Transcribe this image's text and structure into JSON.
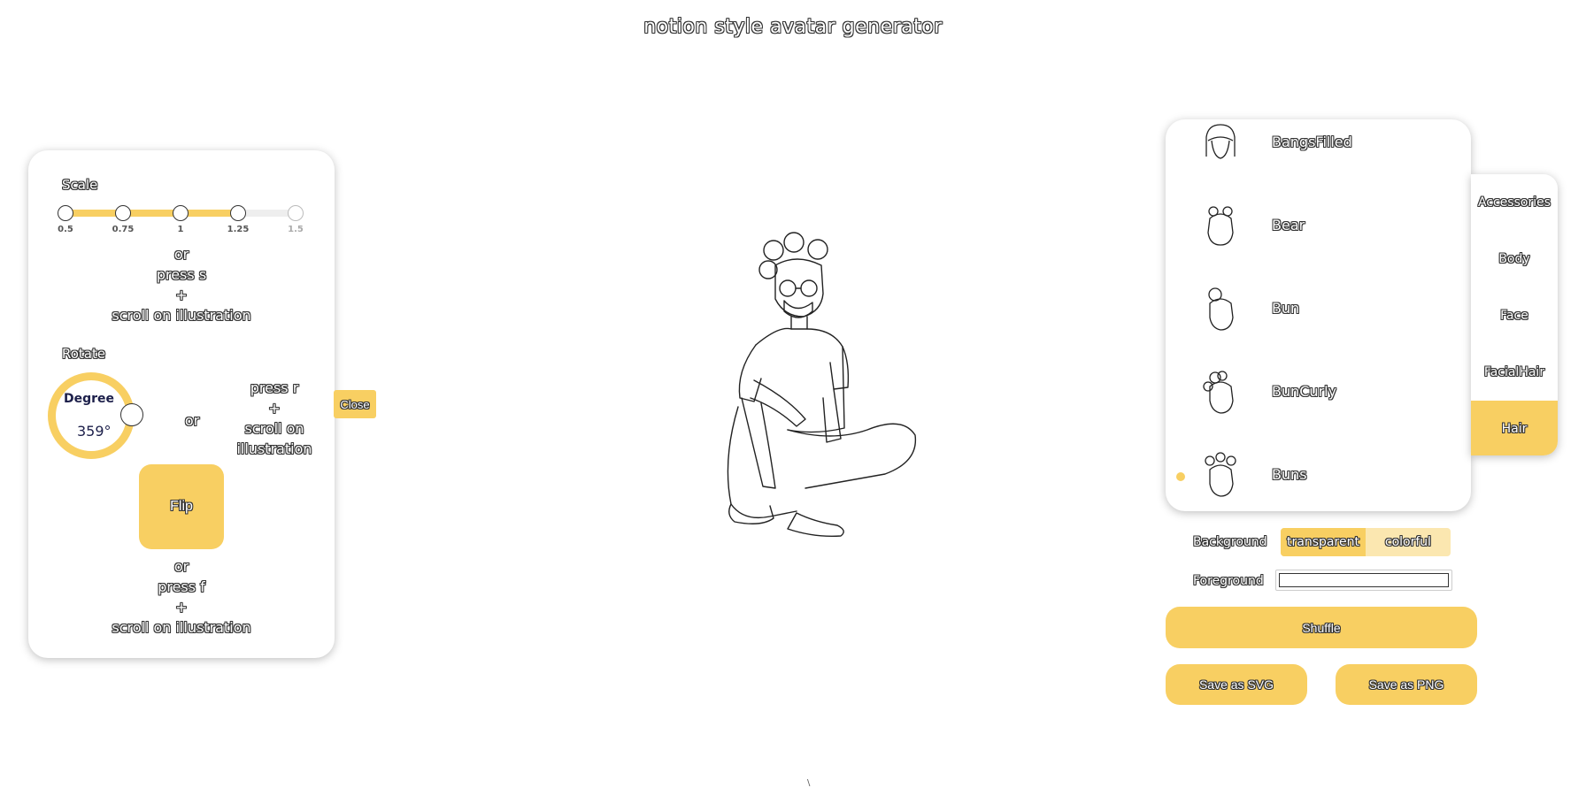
{
  "title": "notion style avatar generator",
  "left_panel": {
    "scale_label": "Scale",
    "scale_ticks": [
      "0.5",
      "0.75",
      "1",
      "1.25",
      "1.5"
    ],
    "scale_selected": "1.25",
    "scale_help": [
      "or",
      "press s",
      "+",
      "scroll on illustration"
    ],
    "rotate_label": "Rotate",
    "dial_label": "Degree",
    "dial_value": "359°",
    "rotate_or": "or",
    "rotate_help": [
      "press r",
      "+",
      "scroll on",
      "illustration"
    ],
    "flip_label": "Flip",
    "flip_help": [
      "or",
      "press f",
      "+",
      "scroll on illustration"
    ],
    "close_label": "Close"
  },
  "part_list": {
    "items": [
      {
        "label": "BangsFilled",
        "icon": "hair-bangs-icon",
        "selected": false
      },
      {
        "label": "Bear",
        "icon": "hair-bear-icon",
        "selected": false
      },
      {
        "label": "Bun",
        "icon": "hair-bun-icon",
        "selected": false
      },
      {
        "label": "BunCurly",
        "icon": "hair-bun-curly-icon",
        "selected": false
      },
      {
        "label": "Buns",
        "icon": "hair-buns-icon",
        "selected": true
      }
    ]
  },
  "category_tabs": [
    {
      "label": "Accessories",
      "active": false
    },
    {
      "label": "Body",
      "active": false
    },
    {
      "label": "Face",
      "active": false
    },
    {
      "label": "FacialHair",
      "active": false
    },
    {
      "label": "Hair",
      "active": true
    }
  ],
  "background": {
    "label": "Background",
    "options": [
      "transparent",
      "colorful"
    ],
    "selected": "transparent"
  },
  "foreground": {
    "label": "Foreground",
    "value": "#ffffff"
  },
  "buttons": {
    "shuffle": "Shuffle",
    "save_svg": "Save as SVG",
    "save_png": "Save as PNG"
  },
  "colors": {
    "accent": "#f8cf62",
    "accent_light": "#fbe7b0",
    "dial_text": "#1c1f4a"
  },
  "footer_mark": "\\"
}
